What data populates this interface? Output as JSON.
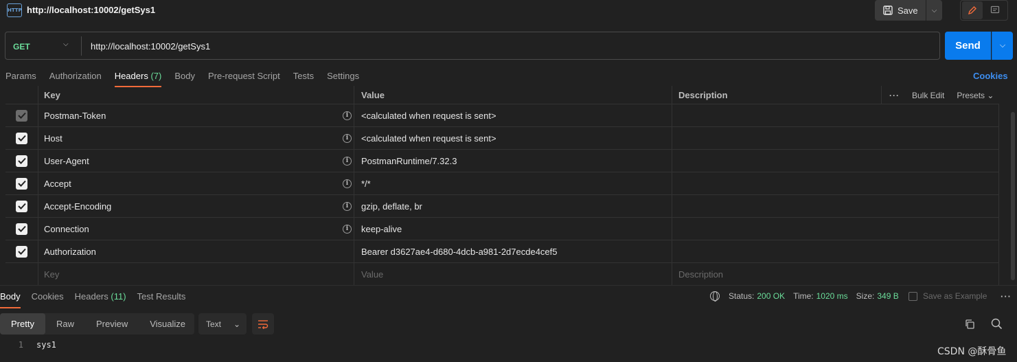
{
  "request": {
    "title": "http://localhost:10002/getSys1",
    "method": "GET",
    "url": "http://localhost:10002/getSys1",
    "http_icon": "HTTP"
  },
  "toolbar": {
    "save_label": "Save",
    "send_label": "Send"
  },
  "request_tabs": [
    {
      "label": "Params"
    },
    {
      "label": "Authorization"
    },
    {
      "label": "Headers",
      "count": "(7)"
    },
    {
      "label": "Body"
    },
    {
      "label": "Pre-request Script"
    },
    {
      "label": "Tests"
    },
    {
      "label": "Settings"
    }
  ],
  "cookies_label": "Cookies",
  "headers_table": {
    "columns": {
      "key": "Key",
      "value": "Value",
      "description": "Description"
    },
    "bulk_edit": "Bulk Edit",
    "presets": "Presets",
    "rows": [
      {
        "key": "Postman-Token",
        "value": "<calculated when request is sent>",
        "checked": true,
        "disabled": true,
        "info": true
      },
      {
        "key": "Host",
        "value": "<calculated when request is sent>",
        "checked": true,
        "disabled": false,
        "info": true
      },
      {
        "key": "User-Agent",
        "value": "PostmanRuntime/7.32.3",
        "checked": true,
        "disabled": false,
        "info": true
      },
      {
        "key": "Accept",
        "value": "*/*",
        "checked": true,
        "disabled": false,
        "info": true
      },
      {
        "key": "Accept-Encoding",
        "value": "gzip, deflate, br",
        "checked": true,
        "disabled": false,
        "info": true
      },
      {
        "key": "Connection",
        "value": "keep-alive",
        "checked": true,
        "disabled": false,
        "info": true
      },
      {
        "key": "Authorization",
        "value": "Bearer d3627ae4-d680-4dcb-a981-2d7ecde4cef5",
        "checked": true,
        "disabled": false,
        "info": false
      }
    ],
    "placeholder": {
      "key": "Key",
      "value": "Value",
      "description": "Description"
    }
  },
  "response": {
    "tabs": [
      {
        "label": "Body"
      },
      {
        "label": "Cookies"
      },
      {
        "label": "Headers",
        "count": "(11)"
      },
      {
        "label": "Test Results"
      }
    ],
    "status_label": "Status:",
    "status_value": "200 OK",
    "time_label": "Time:",
    "time_value": "1020 ms",
    "size_label": "Size:",
    "size_value": "349 B",
    "save_example": "Save as Example",
    "view_modes": [
      "Pretty",
      "Raw",
      "Preview",
      "Visualize"
    ],
    "format": "Text",
    "lines": [
      {
        "number": "1",
        "text": "sys1"
      }
    ]
  },
  "watermark": "CSDN @酥骨鱼",
  "colors": {
    "accent": "#f26b3a",
    "send": "#097bed",
    "method_get": "#6bdd9a",
    "status_ok": "#6bdd9a",
    "link": "#3d8ef0"
  }
}
